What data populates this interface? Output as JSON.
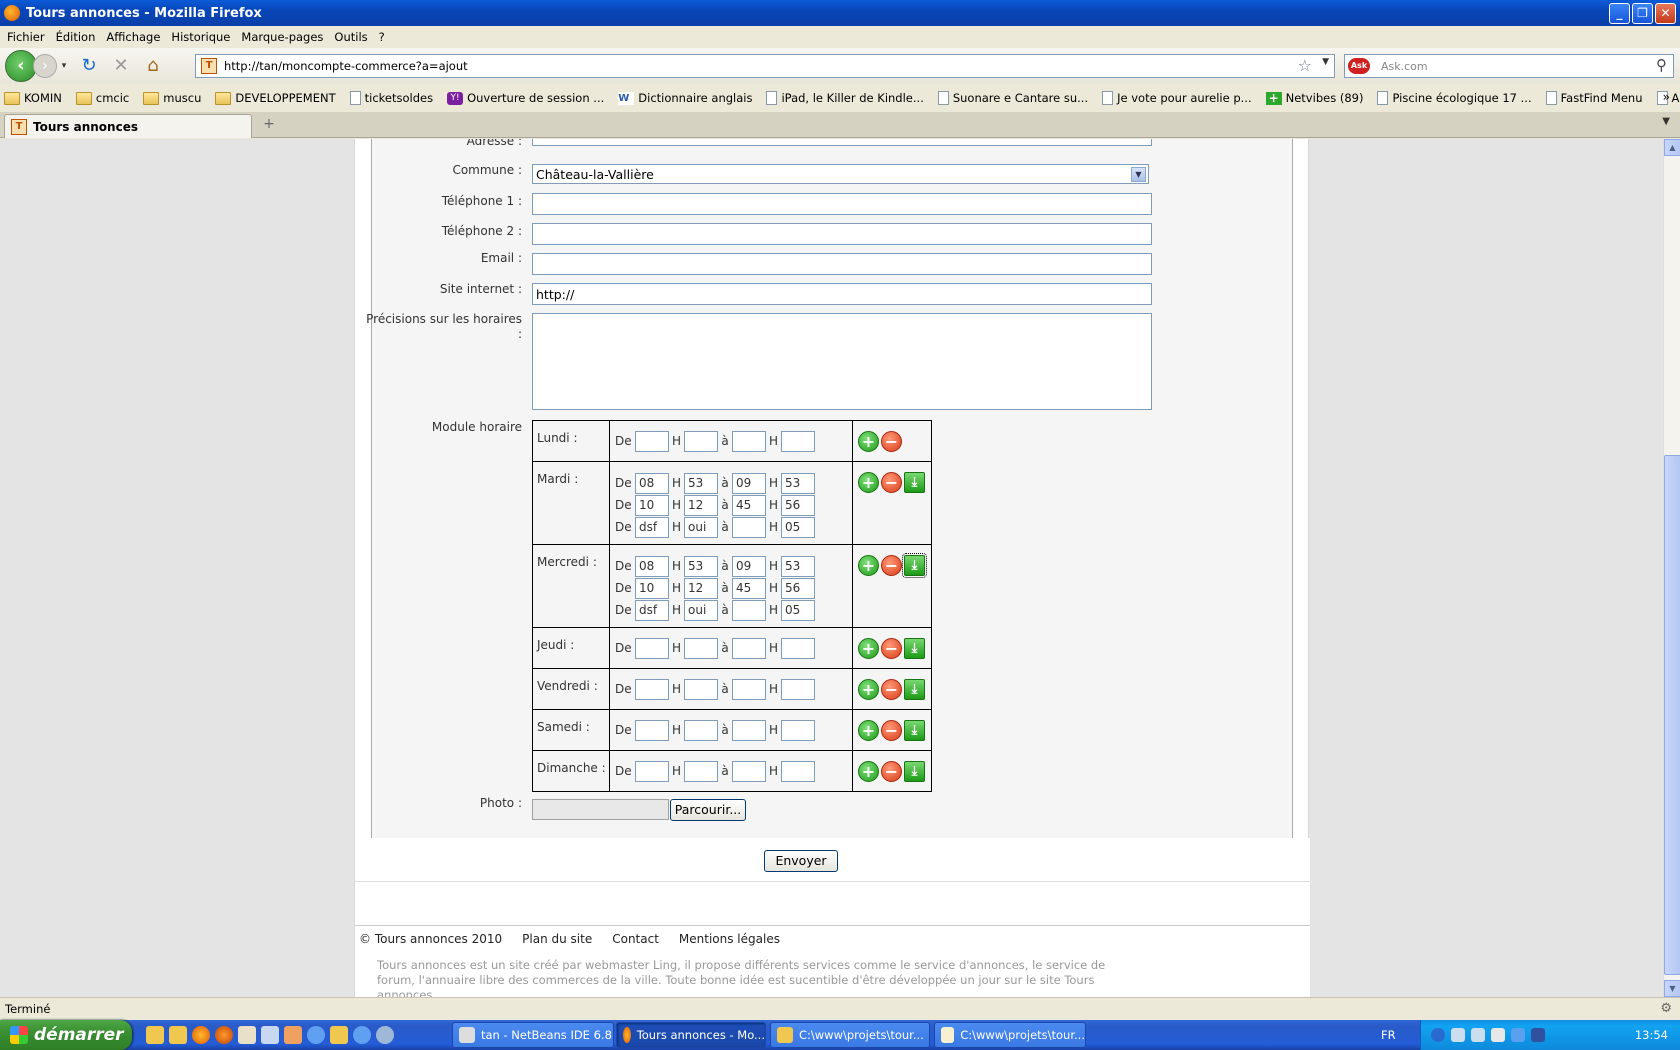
{
  "window": {
    "title": "Tours annonces - Mozilla Firefox"
  },
  "menu": [
    "Fichier",
    "Édition",
    "Affichage",
    "Historique",
    "Marque-pages",
    "Outils",
    "?"
  ],
  "url": "http://tan/moncompte-commerce?a=ajout",
  "search_placeholder": "Ask.com",
  "bookmarks": [
    {
      "label": "KOMIN",
      "icon": "folder"
    },
    {
      "label": "cmcic",
      "icon": "folder"
    },
    {
      "label": "muscu",
      "icon": "folder"
    },
    {
      "label": "DEVELOPPEMENT",
      "icon": "folder"
    },
    {
      "label": "ticketsoldes",
      "icon": "page"
    },
    {
      "label": "Ouverture de session ...",
      "icon": "yahoo"
    },
    {
      "label": "Dictionnaire anglais",
      "icon": "wr"
    },
    {
      "label": "iPad, le Killer de Kindle...",
      "icon": "page"
    },
    {
      "label": "Suonare e Cantare su...",
      "icon": "page"
    },
    {
      "label": "Je vote pour aurelie p...",
      "icon": "page"
    },
    {
      "label": "Netvibes (89)",
      "icon": "nv"
    },
    {
      "label": "Piscine écologique 17 ...",
      "icon": "page"
    },
    {
      "label": "FastFind Menu",
      "icon": "page"
    },
    {
      "label": "Apprendre la dactylog...",
      "icon": "page"
    }
  ],
  "tab": {
    "title": "Tours annonces"
  },
  "form": {
    "adresse_label": "Adresse :",
    "commune_label": "Commune :",
    "commune_value": "Château-la-Vallière",
    "tel1_label": "Téléphone 1 :",
    "tel2_label": "Téléphone 2 :",
    "email_label": "Email :",
    "site_label": "Site internet :",
    "site_value": "http://",
    "precisions_label_1": "Précisions sur les horaires",
    "precisions_label_2": ":",
    "module_label": "Module horaire",
    "photo_label": "Photo :",
    "browse_button": "Parcourir...",
    "submit_button": "Envoyer"
  },
  "hours_words": {
    "de": "De",
    "h": "H",
    "a": "à"
  },
  "days": [
    {
      "name": "Lundi :",
      "slots": [
        [
          "",
          "",
          "",
          ""
        ]
      ],
      "download": false
    },
    {
      "name": "Mardi :",
      "slots": [
        [
          "08",
          "53",
          "09",
          "53"
        ],
        [
          "10",
          "12",
          "45",
          "56"
        ],
        [
          "dsf",
          "oui",
          "",
          "05"
        ]
      ],
      "download": true
    },
    {
      "name": "Mercredi :",
      "slots": [
        [
          "08",
          "53",
          "09",
          "53"
        ],
        [
          "10",
          "12",
          "45",
          "56"
        ],
        [
          "dsf",
          "oui",
          "",
          "05"
        ]
      ],
      "download": true
    },
    {
      "name": "Jeudi :",
      "slots": [
        [
          "",
          "",
          "",
          ""
        ]
      ],
      "download": true
    },
    {
      "name": "Vendredi :",
      "slots": [
        [
          "",
          "",
          "",
          ""
        ]
      ],
      "download": true
    },
    {
      "name": "Samedi :",
      "slots": [
        [
          "",
          "",
          "",
          ""
        ]
      ],
      "download": true
    },
    {
      "name": "Dimanche :",
      "slots": [
        [
          "",
          "",
          "",
          ""
        ]
      ],
      "download": true
    }
  ],
  "footer": {
    "copyright": "© Tours annonces 2010",
    "plan": "Plan du site",
    "contact": "Contact",
    "mentions": "Mentions légales",
    "about": "Tours annonces est un site créé par webmaster Ling, il propose différents services comme le service d'annonces, le service de forum, l'annuaire libre des commerces de la ville. Toute bonne idée est sucentible d'être développée un jour sur le site Tours annonces."
  },
  "status": "Terminé",
  "taskbar": {
    "start": "démarrer",
    "tasks": [
      "tan - NetBeans IDE 6.8",
      "Tours annonces - Mo...",
      "C:\\www\\projets\\tour...",
      "C:\\www\\projets\\tour..."
    ],
    "lang": "FR",
    "clock": "13:54"
  }
}
